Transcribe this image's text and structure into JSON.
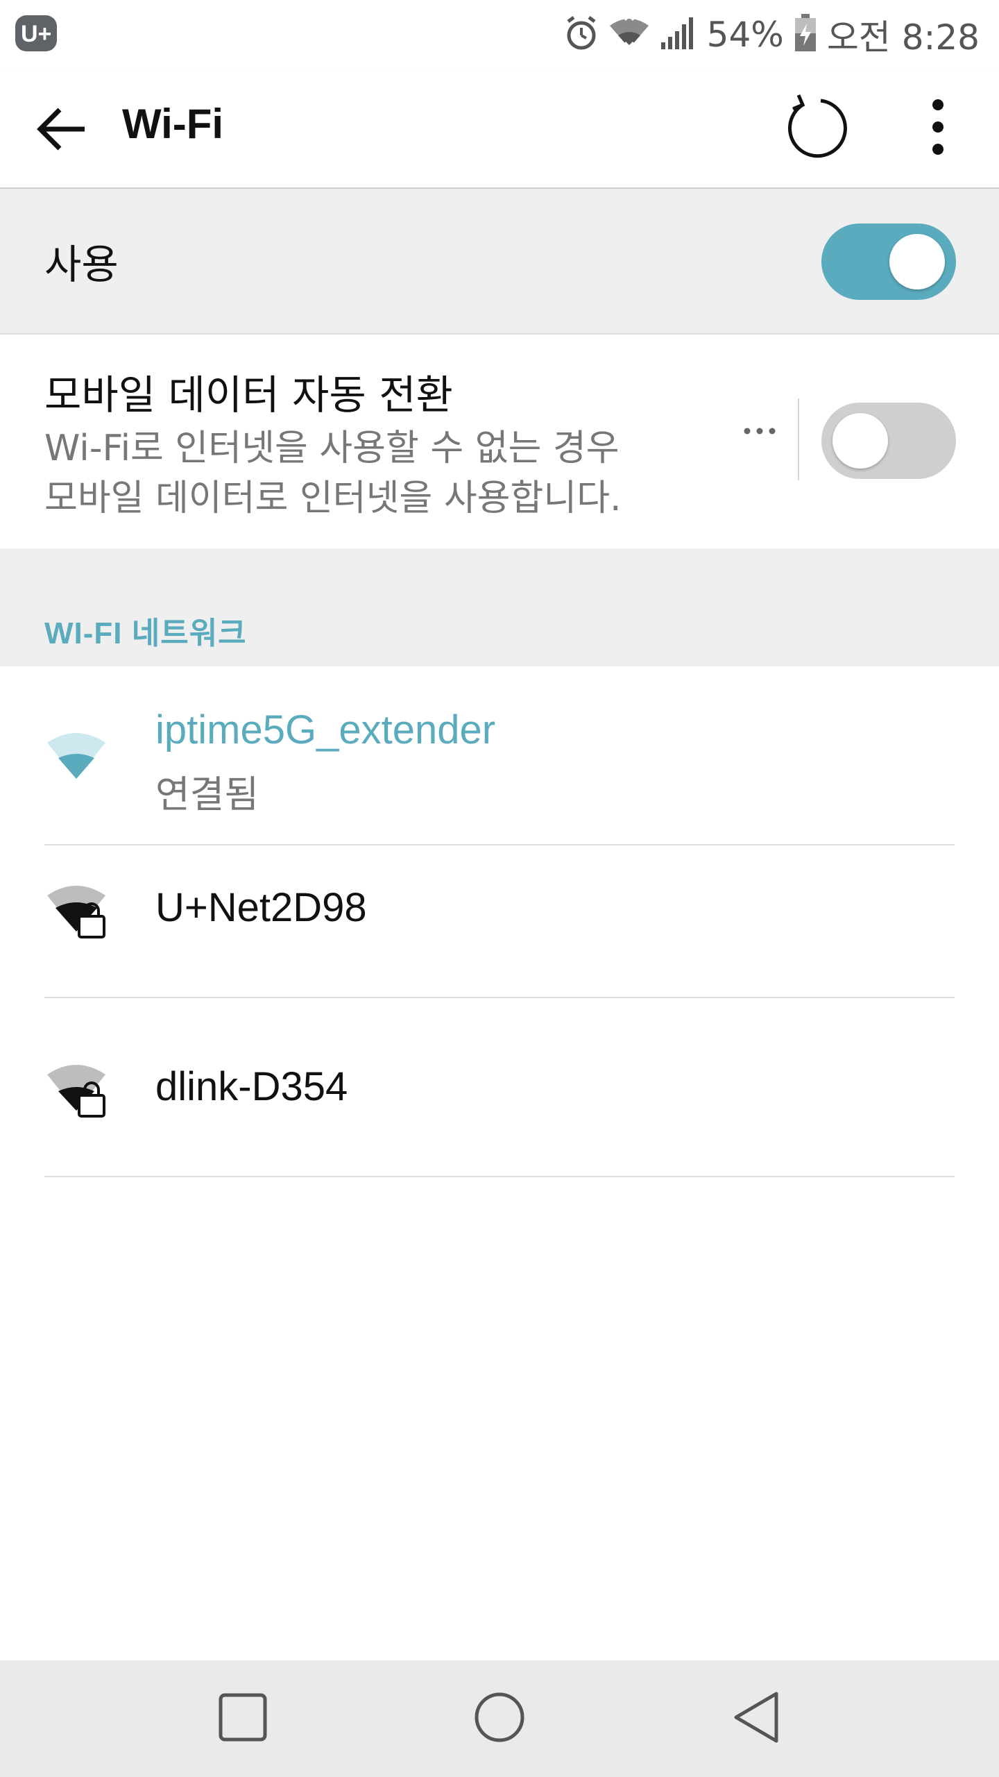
{
  "status_bar": {
    "carrier_logo": "U+",
    "battery_percent": "54%",
    "time": "오전 8:28",
    "icons": [
      "alarm-icon",
      "wifi-signal-icon",
      "cell-signal-icon",
      "battery-charging-icon"
    ]
  },
  "app_bar": {
    "title": "Wi-Fi",
    "back_icon": "arrow-back-icon",
    "refresh_icon": "refresh-icon",
    "more_icon": "more-vert-icon"
  },
  "wifi_master": {
    "label": "사용",
    "enabled": true
  },
  "mobile_data_switch": {
    "title": "모바일 데이터 자동 전환",
    "description_line1": "Wi-Fi로 인터넷을 사용할 수 없는 경우",
    "description_line2": "모바일 데이터로 인터넷을 사용합니다.",
    "more_icon": "more-horiz-icon",
    "enabled": false
  },
  "section": {
    "header": "WI-FI 네트워크"
  },
  "networks": [
    {
      "name": "iptime5G_extender",
      "status": "연결됨",
      "connected": true,
      "secured": false,
      "icon": "wifi-connected-icon"
    },
    {
      "name": "U+Net2D98",
      "status": "",
      "connected": false,
      "secured": true,
      "icon": "wifi-lock-icon"
    },
    {
      "name": "dlink-D354",
      "status": "",
      "connected": false,
      "secured": true,
      "icon": "wifi-lock-icon"
    }
  ],
  "nav_bar": {
    "buttons": [
      "recents-icon",
      "home-icon",
      "back-triangle-icon"
    ]
  },
  "colors": {
    "accent": "#5aabbe",
    "toggle_off": "#cfcfcf",
    "section_bg": "#efefef",
    "nav_bg": "#e9eaec"
  }
}
